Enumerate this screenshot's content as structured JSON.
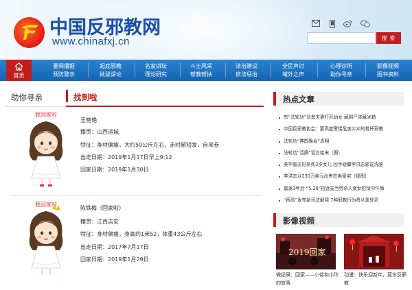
{
  "header": {
    "site_title": "中国反邪教网",
    "site_url": "www.chinafxj.cn",
    "search_button": "搜 索",
    "search_placeholder": ""
  },
  "nav": {
    "home": "首页",
    "items": [
      {
        "line1": "要闻播报",
        "line2": "预防警示"
      },
      {
        "line1": "起底邪教",
        "line2": "批驳谬论"
      },
      {
        "line1": "名家讲坛",
        "line2": "理论研究"
      },
      {
        "line1": "斗士风采",
        "line2": "帮教帮扶"
      },
      {
        "line1": "法治建设",
        "line2": "依法惩治"
      },
      {
        "line1": "全民声讨",
        "line2": "域外之声"
      },
      {
        "line1": "心理诊所",
        "line2": "助你寻亲"
      },
      {
        "line1": "影像视频",
        "line2": "图书资料"
      }
    ]
  },
  "left": {
    "tab_help": "助你寻亲",
    "tab_found": "找到啦",
    "persons": [
      {
        "caption": "我回家啦",
        "name": "王艳艳",
        "hometown": "籍贯：山西运城",
        "features": "特征：身材偏瘦，大约50公斤左右，走时留短发，自来卷",
        "left_date": "出走日期：2019年1月17日早上9:12",
        "return_date": "回家日期：2019年1月30日"
      },
      {
        "caption": "我回家啦",
        "name": "陈铁梅（回家啦）",
        "hometown": "籍贯：江西吉安",
        "features": "特征：身材偏瘦，身高约1米52，体重43公斤左右",
        "left_date": "出走日期：2017年7月17日",
        "return_date": "回家日期：2019年1月29日"
      }
    ]
  },
  "right": {
    "hot_title": "热点文章",
    "hot_items": [
      "有“法轮功”背景夫妻打死幼女 藏剩尸体藏冰箱",
      "中国反邪教协会：要高度警惕危害公众的骨杆邪教",
      "法轮功“神韵晚会”真相",
      "法轮功“活摘”谣言始末（图）",
      "美华裔夫妇杀死3岁女儿 凶手疑攀李洪志邪说洗脑",
      "李洪志以230万美元出售在美豪宅（视图）",
      "震发3年后 “5·28”招远麦当劳杀人案女犯狱中忏悔",
      "“西高”发布新司法解释 7种邪教行为将从重处罚"
    ],
    "video_title": "影像视频",
    "videos": [
      {
        "caption": "微纪录：回家——小徐和小玲的故事",
        "overlay": "2019回家"
      },
      {
        "caption": "动漫：快乐迎新年，莫忘反邪教",
        "overlay": ""
      }
    ]
  },
  "colors": {
    "brand_blue": "#1a4fa8",
    "nav_blue": "#1565b2",
    "accent_red": "#c41d1d"
  }
}
